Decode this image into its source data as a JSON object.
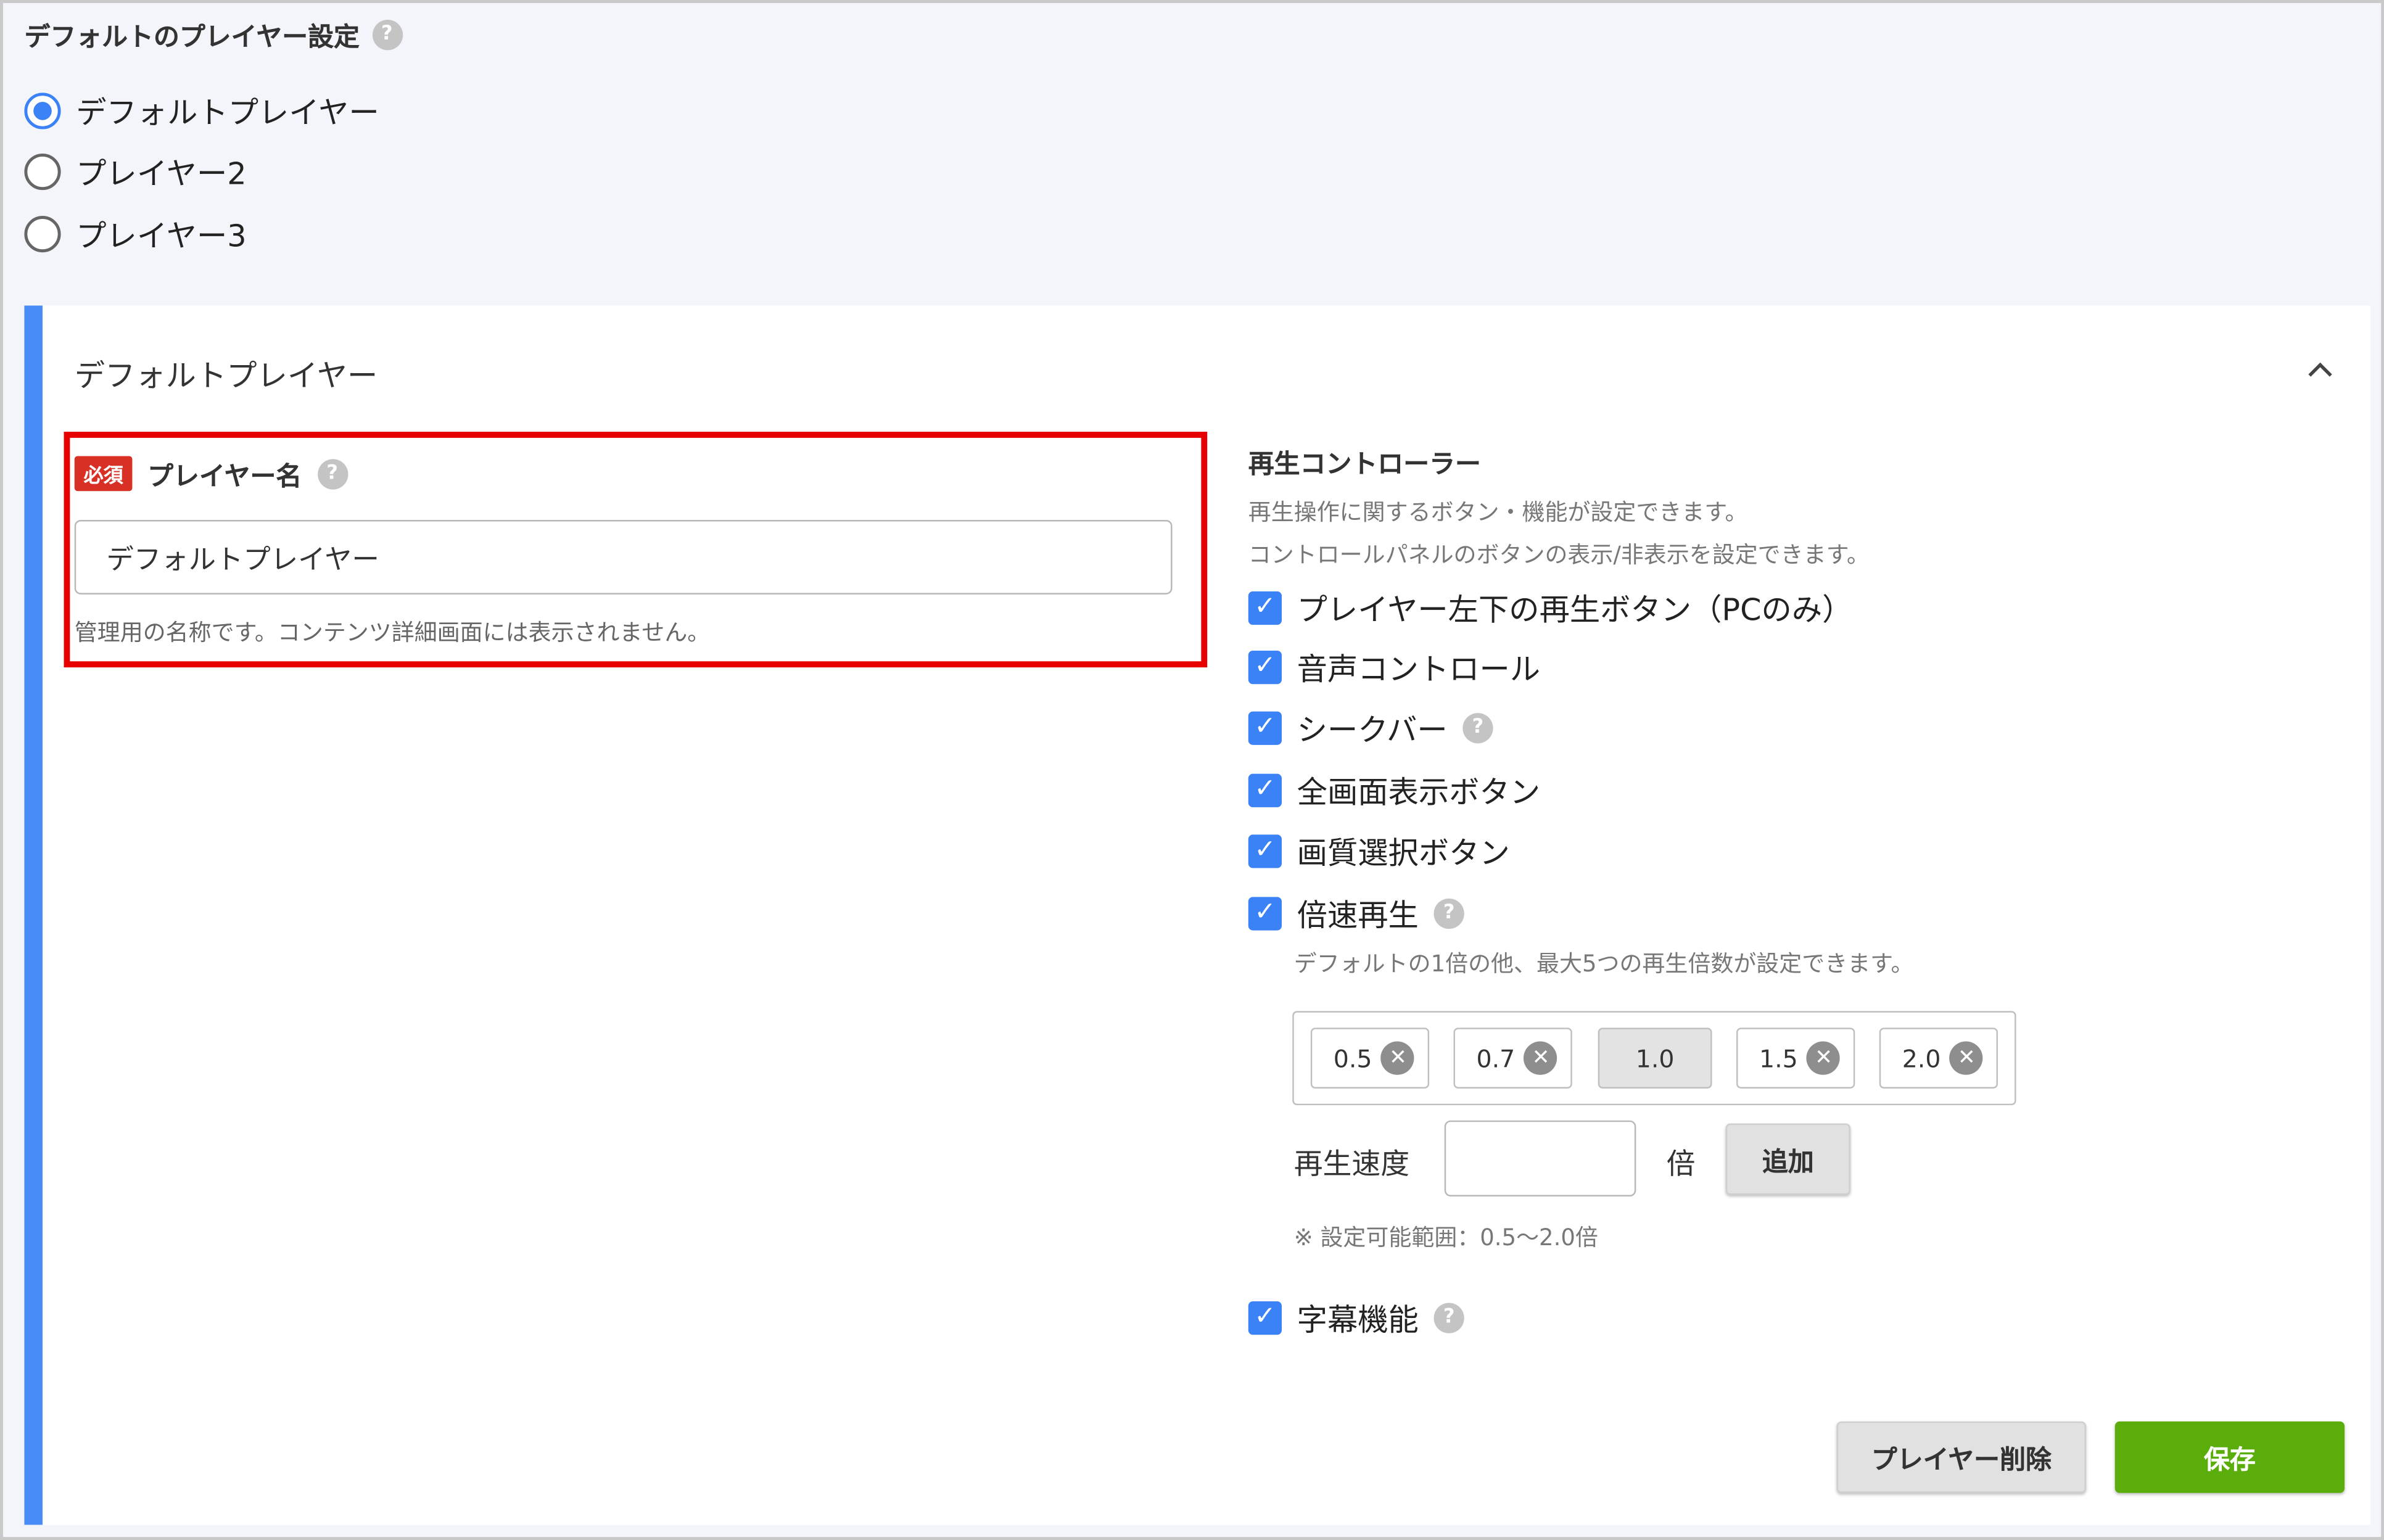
{
  "player_settings": {
    "title": "デフォルトのプレイヤー設定",
    "options": [
      "デフォルトプレイヤー",
      "プレイヤー2",
      "プレイヤー3"
    ],
    "selected": "デフォルトプレイヤー"
  },
  "panel": {
    "title": "デフォルトプレイヤー",
    "collapse_icon": "chevron-up-icon"
  },
  "player_name": {
    "required_badge": "必須",
    "label": "プレイヤー名",
    "value": "デフォルトプレイヤー",
    "help": "管理用の名称です。コンテンツ詳細画面には表示されません。"
  },
  "controller": {
    "title": "再生コントローラー",
    "desc1": "再生操作に関するボタン・機能が設定できます。",
    "desc2": "コントロールパネルのボタンの表示/非表示を設定できます。",
    "items": [
      {
        "label": "プレイヤー左下の再生ボタン（PCのみ）",
        "checked": true
      },
      {
        "label": "音声コントロール",
        "checked": true
      },
      {
        "label": "シークバー",
        "checked": true
      },
      {
        "label": "全画面表示ボタン",
        "checked": true
      },
      {
        "label": "画質選択ボタン",
        "checked": true
      },
      {
        "label": "倍速再生",
        "checked": true
      }
    ],
    "speed_desc": "デフォルトの1倍の他、最大5つの再生倍数が設定できます。",
    "speeds": [
      "0.5",
      "0.7",
      "1.0",
      "1.5",
      "2.0"
    ],
    "fixed_speed": "1.0",
    "speed_label": "再生速度",
    "speed_input": "",
    "speed_unit": "倍",
    "add_button": "追加",
    "range_note": "※ 設定可能範囲：0.5〜2.0倍",
    "subtitle": {
      "label": "字幕機能",
      "checked": true
    }
  },
  "actions": {
    "delete": "プレイヤー削除",
    "save": "保存"
  },
  "colors": {
    "accent_blue": "#4a8cf7",
    "checkbox_blue": "#3b82f6",
    "required_red": "#d93025",
    "highlight_red": "#e60000",
    "save_green": "#5aad0b"
  }
}
